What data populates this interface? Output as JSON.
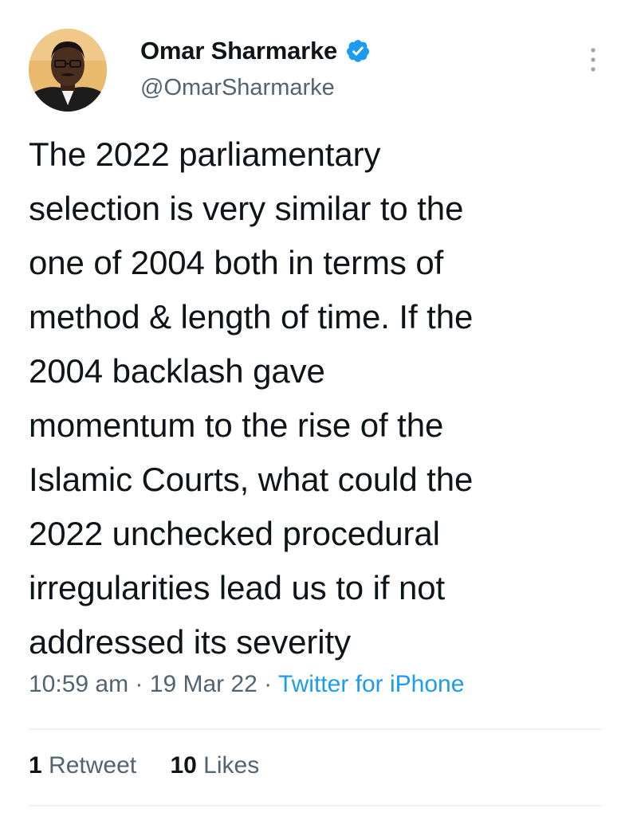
{
  "author": {
    "display_name": "Omar Sharmarke",
    "handle": "@OmarSharmarke",
    "verified": true
  },
  "tweet": {
    "lines": [
      "The 2022 parliamentary",
      "selection is very similar to the",
      "one of 2004 both in terms of",
      "method & length of time. If the",
      "2004 backlash gave",
      "momentum to the rise of the",
      "Islamic Courts, what could the",
      "2022 unchecked procedural",
      "irregularities lead us to if not",
      "addressed its severity"
    ]
  },
  "meta": {
    "time": "10:59 am",
    "sep1": " · ",
    "date": "19 Mar 22",
    "sep2": " · ",
    "source": "Twitter for iPhone"
  },
  "stats": {
    "retweets_count": "1",
    "retweets_label": "Retweet",
    "likes_count": "10",
    "likes_label": "Likes"
  },
  "colors": {
    "text": "#0f1419",
    "secondary": "#536471",
    "accent": "#1d9bf0",
    "divider": "#eff3f4"
  },
  "icons": {
    "verified": "verified-badge-icon",
    "more": "more-vertical-icon"
  }
}
